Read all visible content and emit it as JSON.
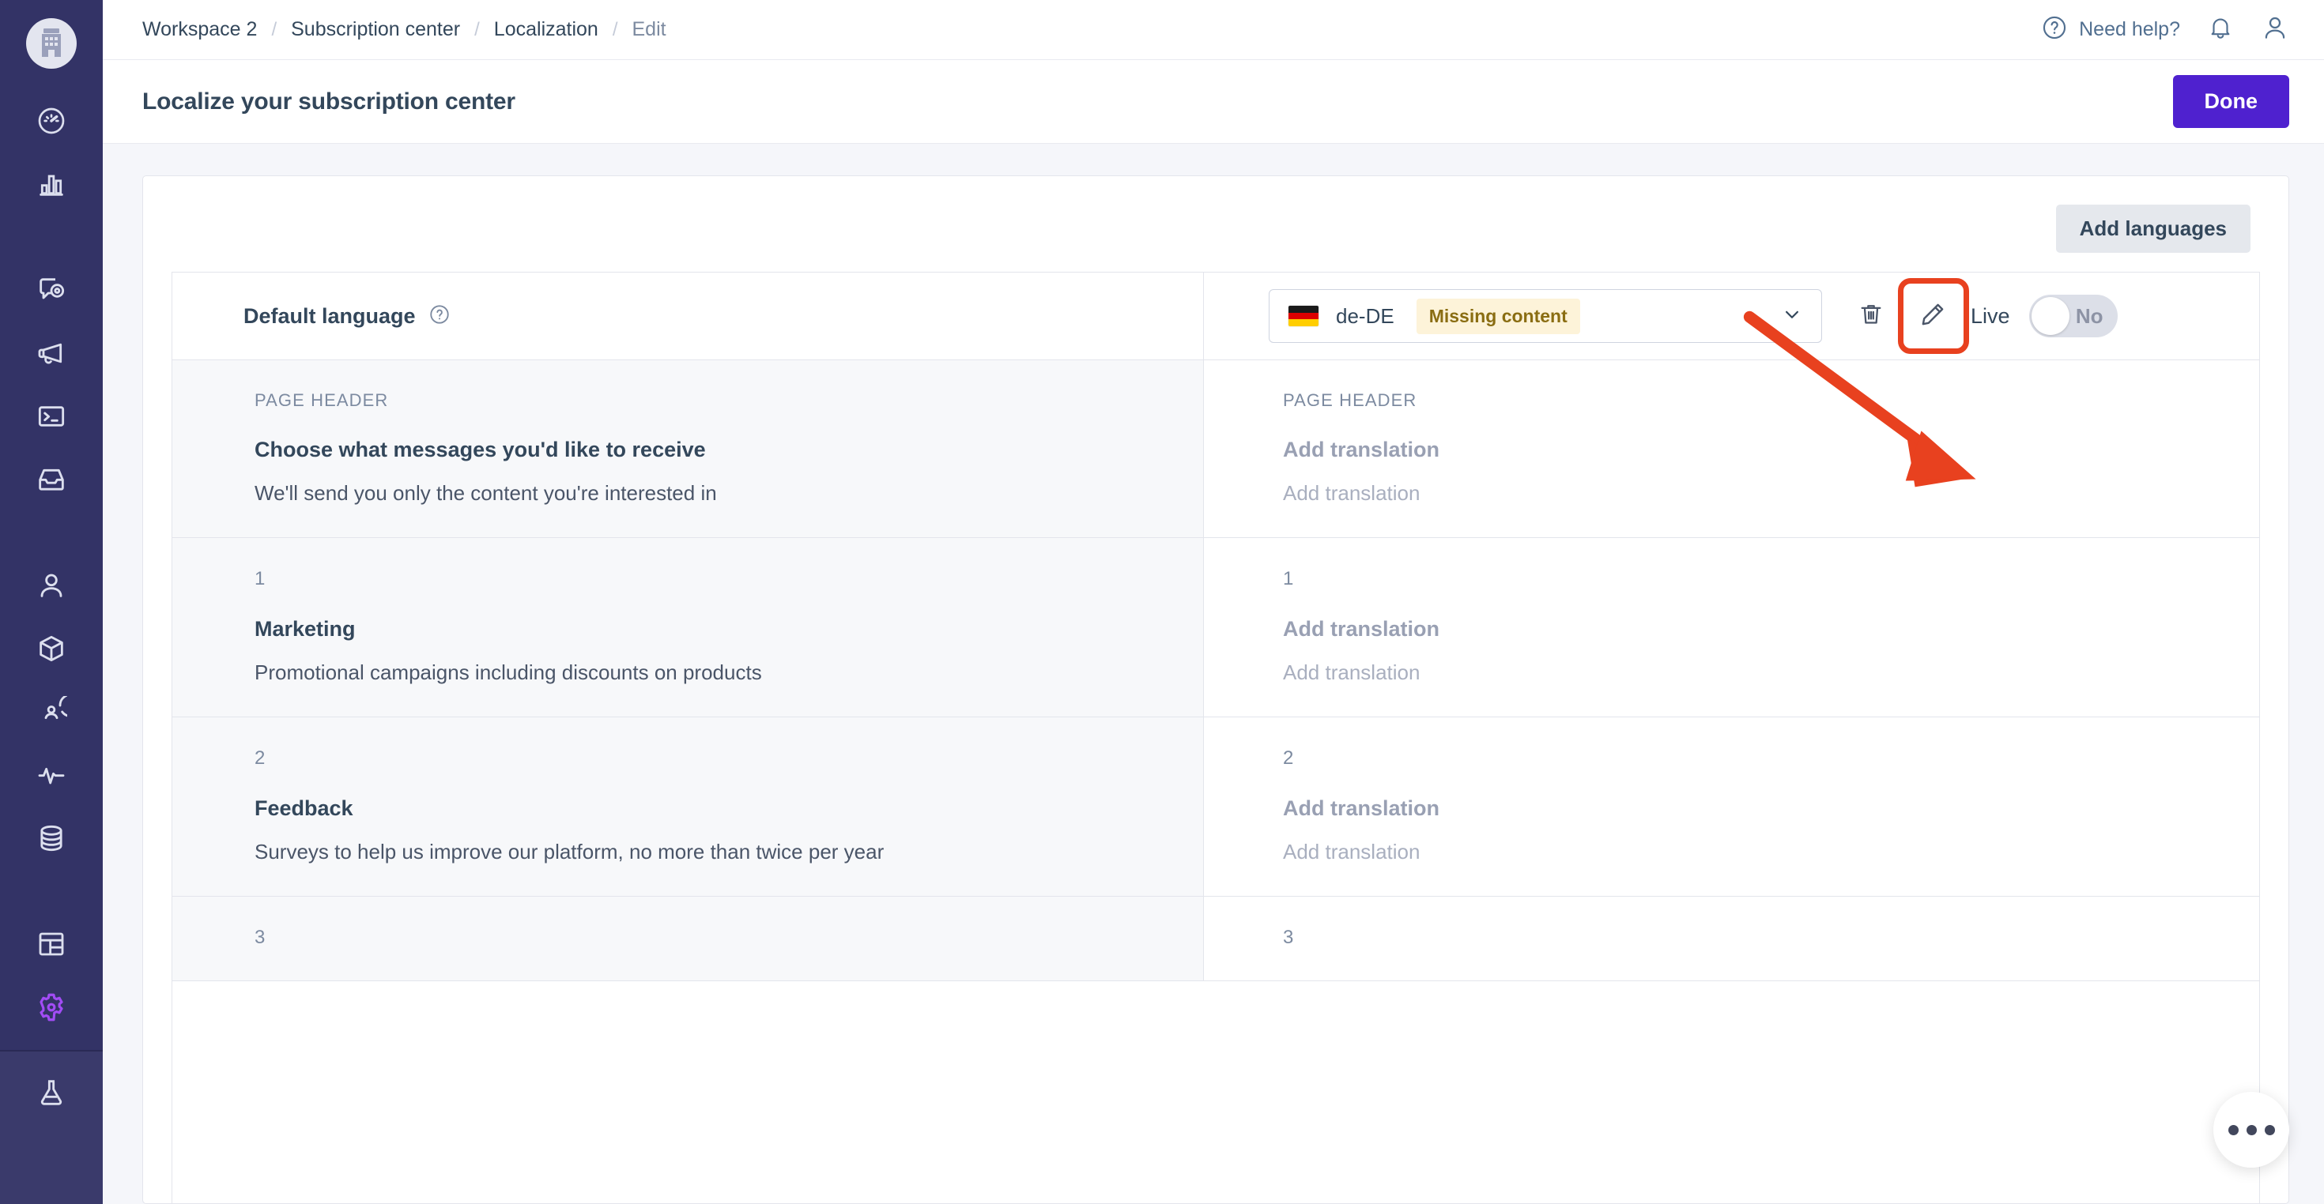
{
  "sidebar": {
    "logo_icon": "building-icon",
    "items": [
      {
        "icon": "gauge-dashboard-icon",
        "name": "sidebar-item-dashboard"
      },
      {
        "icon": "bar-chart-icon",
        "name": "sidebar-item-reports"
      },
      {
        "icon": "chat-target-icon",
        "name": "sidebar-item-conversations"
      },
      {
        "icon": "megaphone-icon",
        "name": "sidebar-item-marketing"
      },
      {
        "icon": "terminal-icon",
        "name": "sidebar-item-developer"
      },
      {
        "icon": "inbox-icon",
        "name": "sidebar-item-inbox"
      },
      {
        "icon": "user-icon",
        "name": "sidebar-item-contacts"
      },
      {
        "icon": "cube-icon",
        "name": "sidebar-item-products"
      },
      {
        "icon": "user-circle-icon",
        "name": "sidebar-item-accounts"
      },
      {
        "icon": "pulse-icon",
        "name": "sidebar-item-activity"
      },
      {
        "icon": "database-icon",
        "name": "sidebar-item-data"
      },
      {
        "icon": "layout-icon",
        "name": "sidebar-item-templates"
      },
      {
        "icon": "gear-icon",
        "name": "sidebar-item-settings",
        "active": true
      },
      {
        "icon": "flask-icon",
        "name": "sidebar-item-labs"
      }
    ]
  },
  "topbar": {
    "breadcrumb": [
      {
        "label": "Workspace 2"
      },
      {
        "label": "Subscription center"
      },
      {
        "label": "Localization"
      },
      {
        "label": "Edit"
      }
    ],
    "separator": "/",
    "need_help_label": "Need help?",
    "help_icon": "question-circle-icon",
    "notifications_icon": "bell-icon",
    "account_icon": "user-avatar-icon"
  },
  "header": {
    "page_title": "Localize your subscription center",
    "done_label": "Done"
  },
  "toolbar": {
    "add_languages_label": "Add languages"
  },
  "language_row": {
    "default_language_label": "Default language",
    "help_icon": "question-circle-icon",
    "flag_country": "de",
    "flag_colors": [
      "#1a1a1a",
      "#dd0000",
      "#ffce00"
    ],
    "lang_code": "de-DE",
    "status_badge": "Missing content",
    "dropdown_icon": "chevron-down-icon",
    "delete_icon": "trash-icon",
    "edit_icon": "pencil-icon",
    "live_label": "Live",
    "toggle_value": "No"
  },
  "rows": [
    {
      "eyebrow": "PAGE HEADER",
      "title": "Choose what messages you'd like to receive",
      "subtitle": "We'll send you only the content you're interested in",
      "t_eyebrow": "PAGE HEADER",
      "t_title": "Add translation",
      "t_subtitle": "Add translation"
    },
    {
      "eyebrow": "1",
      "title": "Marketing",
      "subtitle": "Promotional campaigns including discounts on products",
      "t_eyebrow": "1",
      "t_title": "Add translation",
      "t_subtitle": "Add translation"
    },
    {
      "eyebrow": "2",
      "title": "Feedback",
      "subtitle": "Surveys to help us improve our platform, no more than twice per year",
      "t_eyebrow": "2",
      "t_title": "Add translation",
      "t_subtitle": "Add translation"
    },
    {
      "eyebrow": "3",
      "title": "",
      "subtitle": "",
      "t_eyebrow": "3",
      "t_title": "",
      "t_subtitle": ""
    }
  ],
  "fab": {
    "icon": "more-horizontal-icon"
  },
  "annotation": {
    "arrow_color": "#e8411f",
    "highlight_color": "#e8411f",
    "target": "edit-pencil-button"
  },
  "colors": {
    "sidebar_bg": "#333366",
    "accent_primary": "#4f21cf",
    "accent_active": "#a24cf5",
    "text_primary": "#33475b",
    "text_muted": "#7c8aa0",
    "badge_bg": "#fdf3d9",
    "badge_text": "#8a6d12",
    "annotation": "#e8411f"
  }
}
